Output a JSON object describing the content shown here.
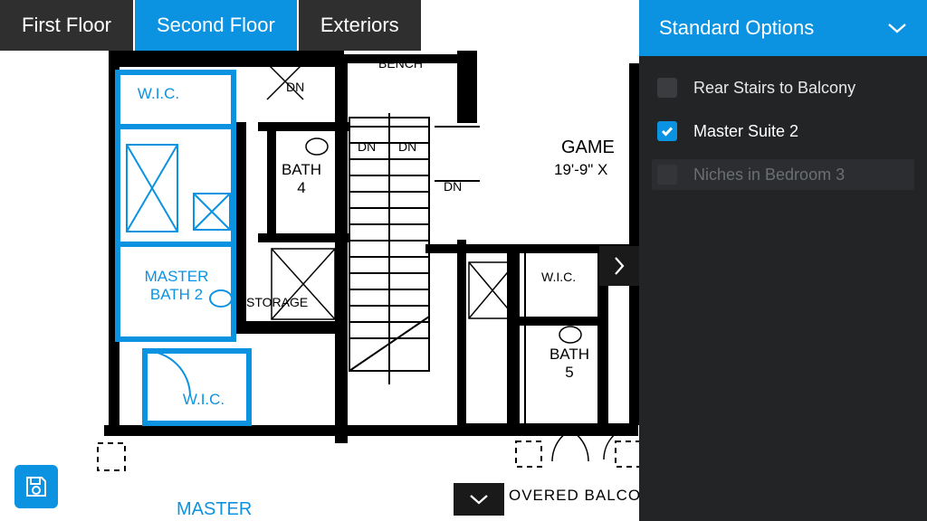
{
  "tabs": [
    {
      "label": "First Floor",
      "active": false
    },
    {
      "label": "Second Floor",
      "active": true
    },
    {
      "label": "Exteriors",
      "active": false
    }
  ],
  "panel": {
    "header": "Standard Options",
    "options": [
      {
        "label": "Rear Stairs to Balcony",
        "state": "unchecked"
      },
      {
        "label": "Master Suite 2",
        "state": "checked"
      },
      {
        "label": "Niches in Bedroom 3",
        "state": "disabled"
      }
    ]
  },
  "plan_labels": {
    "wic1": "W.I.C.",
    "bath4": "BATH\n4",
    "master_bath2": "MASTER\nBATH 2",
    "storage": "STORAGE",
    "wic2": "W.I.C.",
    "wic3": "W.I.C.",
    "bath5": "BATH\n5",
    "game": "GAME",
    "game_dim": "19'-9\" X",
    "bench": "BENCH",
    "master": "MASTER",
    "balcony": "OVERED BALCO",
    "dn1": "DN",
    "dn2": "DN",
    "dn3": "DN",
    "dn4": "DN"
  }
}
